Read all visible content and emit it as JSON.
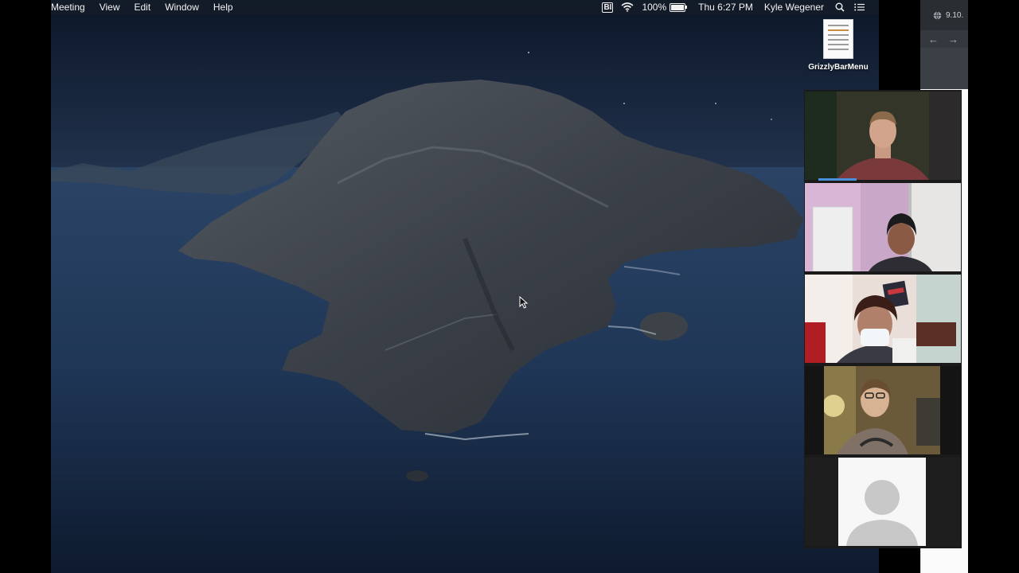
{
  "menubar": {
    "app_menu_partial": "Meeting",
    "menus": [
      "View",
      "Edit",
      "Window",
      "Help"
    ],
    "status": {
      "bi_badge": "BI",
      "wifi_icon": "wifi-icon",
      "battery_percent": "100%",
      "battery_level": 1.0,
      "clock": "Thu 6:27 PM",
      "user": "Kyle Wegener",
      "search_icon": "spotlight-search-icon",
      "list_icon": "notification-center-icon"
    }
  },
  "desktop": {
    "file_label": "GrizzlyBarMenu",
    "file_icon": "document-icon"
  },
  "browser": {
    "tab_text": "9.10.",
    "back_icon": "back-arrow-icon",
    "forward_icon": "forward-arrow-icon",
    "globe_icon": "globe-icon"
  },
  "gallery": {
    "participants": [
      {
        "tile": "participant-video-1",
        "kind": "video"
      },
      {
        "tile": "participant-video-2",
        "kind": "video"
      },
      {
        "tile": "participant-video-3",
        "kind": "video"
      },
      {
        "tile": "participant-video-4",
        "kind": "video"
      },
      {
        "tile": "participant-video-5",
        "kind": "avatar-placeholder"
      }
    ]
  }
}
